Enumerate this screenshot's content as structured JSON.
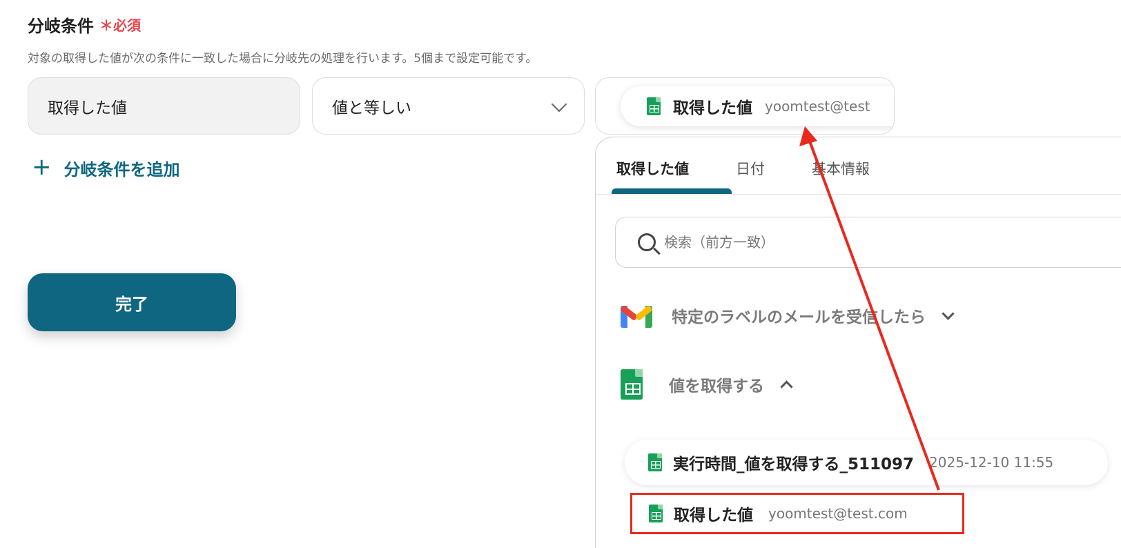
{
  "condition": {
    "label": "分岐条件",
    "required_mark": "＊必須",
    "help_text": "対象の取得した値が次の条件に一致した場合に分岐先の処理を行います。5個まで設定可能です。",
    "left_field_value": "取得した値",
    "operator_value": "値と等しい",
    "value_chip": {
      "title": "取得した値",
      "subtitle": "yoomtest@test"
    },
    "add_condition_label": "分岐条件を追加",
    "done_label": "完了"
  },
  "picker": {
    "tabs": [
      {
        "label": "取得した値",
        "active": true
      },
      {
        "label": "日付",
        "active": false
      },
      {
        "label": "基本情報",
        "active": false
      }
    ],
    "search_placeholder": "検索（前方一致）",
    "groups": [
      {
        "title": "特定のラベルのメールを受信したら",
        "icon": "gmail-icon",
        "expanded": false
      },
      {
        "title": "値を取得する",
        "icon": "google-sheets-icon",
        "expanded": true
      }
    ],
    "items": [
      {
        "title": "実行時間_値を取得する_511097",
        "subtitle": "2025-12-10 11:55"
      },
      {
        "title": "取得した値",
        "subtitle": "yoomtest@test.com"
      }
    ]
  },
  "colors": {
    "accent": "#0f6680",
    "required": "#e5484d",
    "annotation": "#e8291c",
    "sheets_green": "#18a058"
  }
}
